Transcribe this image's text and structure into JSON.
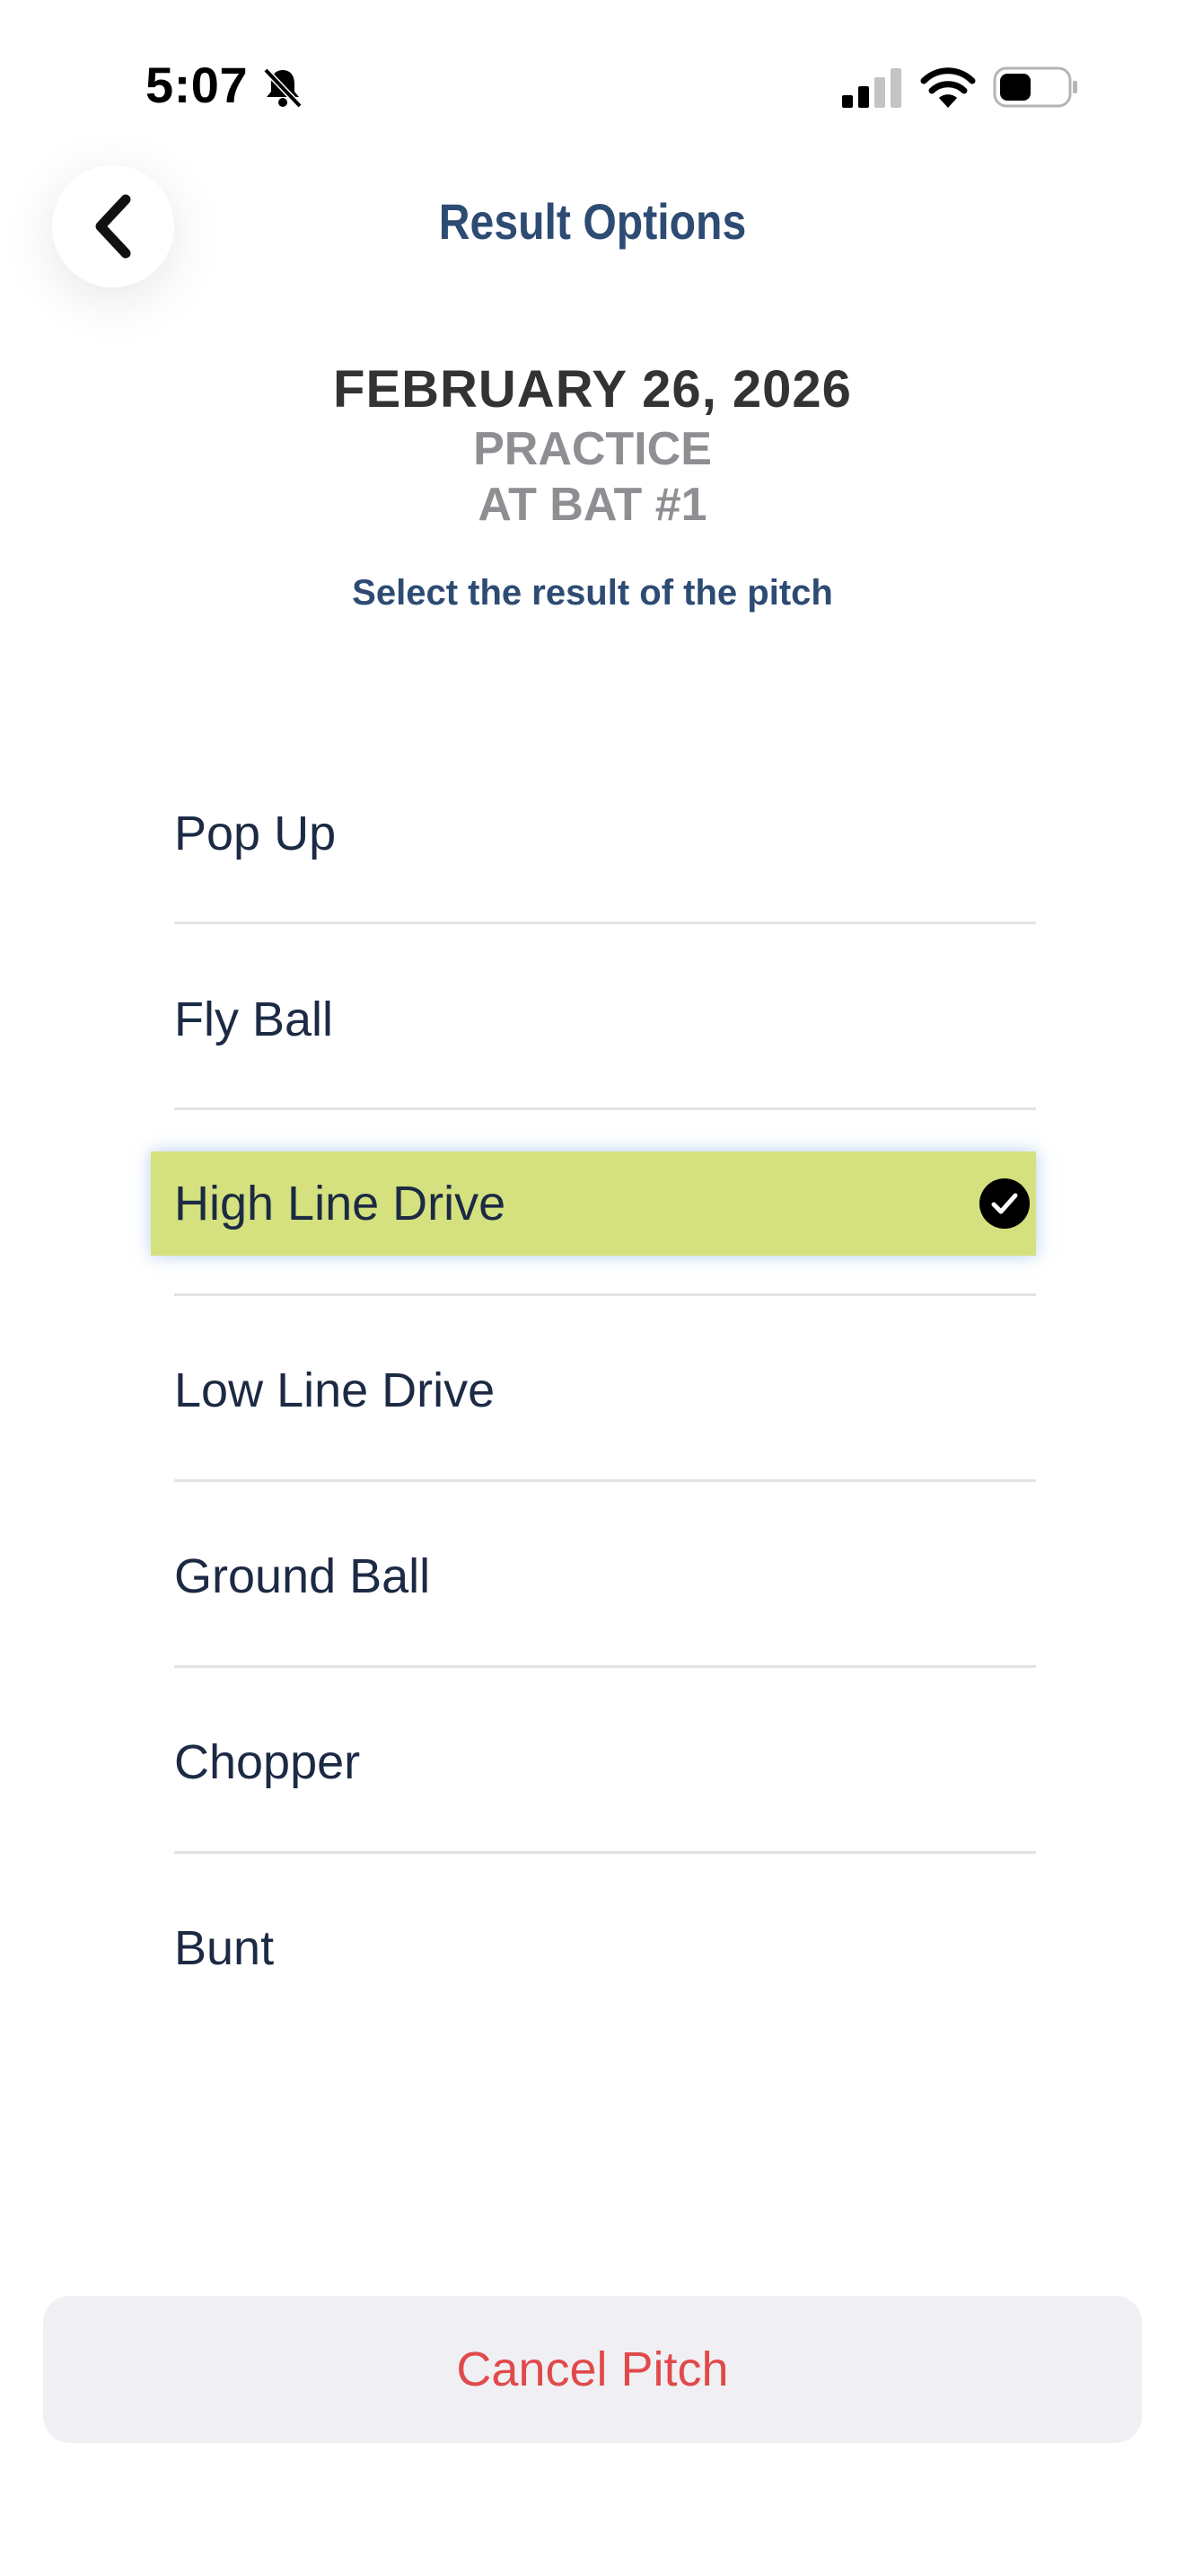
{
  "status_bar": {
    "time": "5:07",
    "icons": [
      "bell-slash-icon",
      "cellular-signal-icon",
      "wifi-icon",
      "battery-icon"
    ]
  },
  "header": {
    "title": "Result Options",
    "back_icon": "chevron-left-icon"
  },
  "session": {
    "date": "FEBRUARY 26, 2026",
    "type": "PRACTICE",
    "at_bat": "AT BAT #1",
    "instruction": "Select the result of the pitch"
  },
  "options": [
    {
      "label": "Pop Up",
      "selected": false
    },
    {
      "label": "Fly Ball",
      "selected": false
    },
    {
      "label": "High Line Drive",
      "selected": true
    },
    {
      "label": "Low Line Drive",
      "selected": false
    },
    {
      "label": "Ground Ball",
      "selected": false
    },
    {
      "label": "Chopper",
      "selected": false
    },
    {
      "label": "Bunt",
      "selected": false
    }
  ],
  "cancel_label": "Cancel Pitch",
  "colors": {
    "title": "#2d4b73",
    "selected_highlight": "#d4e17e",
    "cancel_text": "#e04a4a",
    "option_text": "#1c2a44"
  }
}
